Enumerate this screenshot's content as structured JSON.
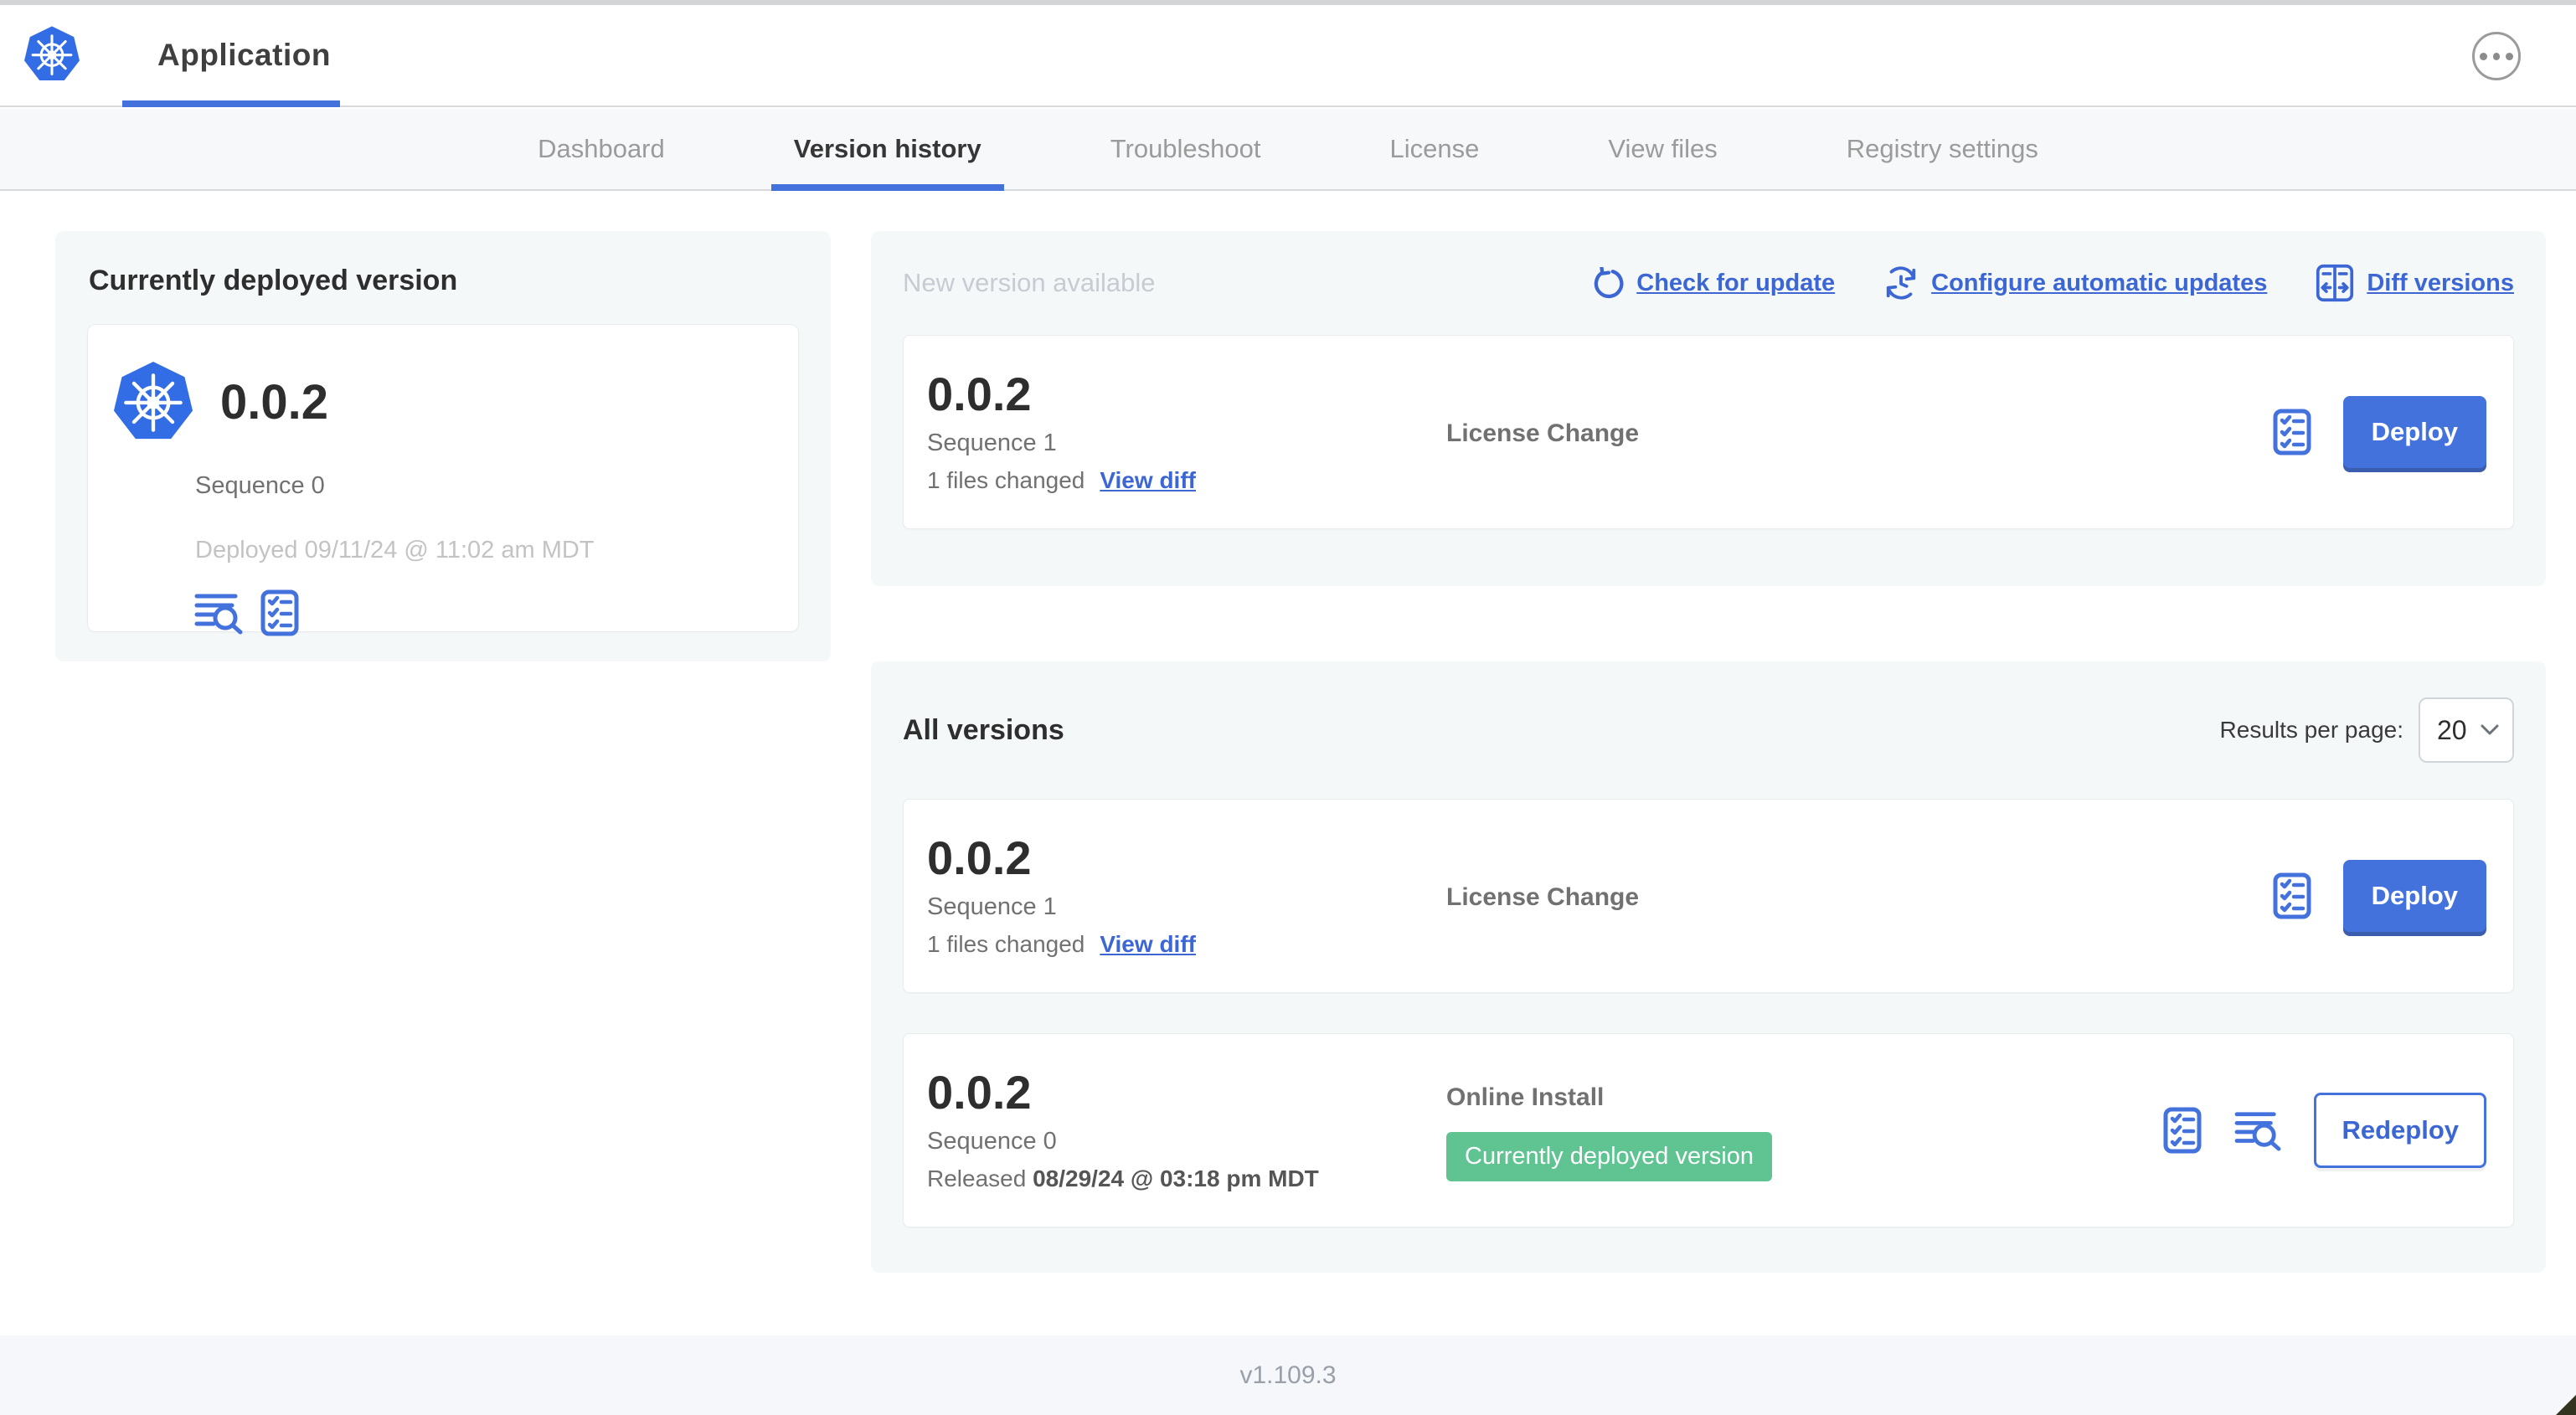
{
  "window": {
    "app_title": "Application"
  },
  "nav": {
    "active_tab": "Version history",
    "tabs": [
      {
        "label": "Dashboard"
      },
      {
        "label": "Version history"
      },
      {
        "label": "Troubleshoot"
      },
      {
        "label": "License"
      },
      {
        "label": "View files"
      },
      {
        "label": "Registry settings"
      }
    ]
  },
  "current_version": {
    "title": "Currently deployed version",
    "version": "0.0.2",
    "sequence": "Sequence 0",
    "deployed": "Deployed 09/11/24 @ 11:02 am MDT"
  },
  "new_version": {
    "title": "New version available",
    "check_for_update": "Check for update",
    "configure_updates": "Configure automatic updates",
    "diff_versions": "Diff versions",
    "card": {
      "version": "0.0.2",
      "sequence": "Sequence 1",
      "files_changed": "1 files changed",
      "view_diff": "View diff",
      "source": "License Change",
      "action_label": "Deploy"
    }
  },
  "all_versions": {
    "title": "All versions",
    "results_label": "Results per page:",
    "results_value": "20",
    "rows": [
      {
        "version": "0.0.2",
        "sequence": "Sequence 1",
        "files_changed": "1 files changed",
        "view_diff": "View diff",
        "source": "License Change",
        "action_label": "Deploy"
      },
      {
        "version": "0.0.2",
        "sequence": "Sequence 0",
        "released_prefix": "Released",
        "released_date": "08/29/24 @ 03:18 pm MDT",
        "source": "Online Install",
        "status_badge": "Currently deployed version",
        "action_label": "Redeploy"
      }
    ]
  },
  "footer": {
    "version": "v1.109.3"
  },
  "colors": {
    "accent_blue": "#4472dd",
    "link_blue": "#3b66d4",
    "k8s_blue": "#326de6",
    "badge_green": "#60c392",
    "panel_gray": "#f5f8f9"
  }
}
